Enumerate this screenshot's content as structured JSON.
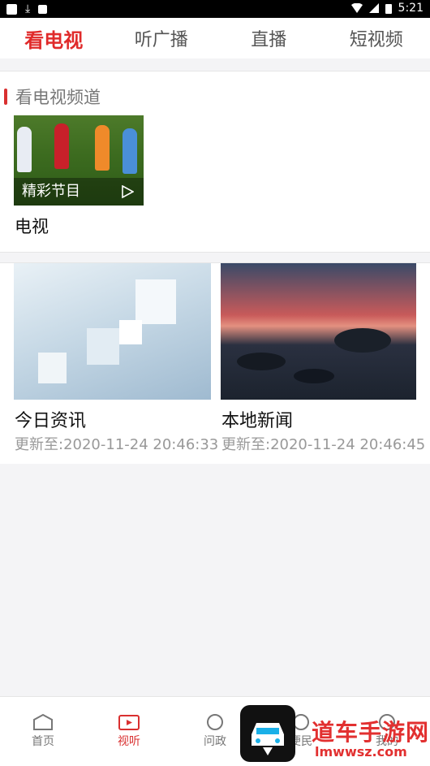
{
  "status_bar": {
    "time": "5:21"
  },
  "top_tabs": [
    {
      "label": "看电视",
      "active": true
    },
    {
      "label": "听广播",
      "active": false
    },
    {
      "label": "直播",
      "active": false
    },
    {
      "label": "短视频",
      "active": false
    }
  ],
  "channel_section": {
    "title": "看电视频道",
    "card": {
      "caption": "精彩节目",
      "title": "电视"
    }
  },
  "news": [
    {
      "title": "今日资讯",
      "updated": "更新至:2020-11-24 20:46:33"
    },
    {
      "title": "本地新闻",
      "updated": "更新至:2020-11-24 20:46:45"
    }
  ],
  "bottom_nav": [
    {
      "label": "首页",
      "icon": "home-icon"
    },
    {
      "label": "视听",
      "icon": "video-icon",
      "active": true
    },
    {
      "label": "问政",
      "icon": "circle-icon"
    },
    {
      "label": "便民",
      "icon": "circle-icon"
    },
    {
      "label": "我的",
      "icon": "user-icon"
    }
  ],
  "watermark": {
    "text": "道车手游网",
    "sub": "lmwwsz.com"
  },
  "colors": {
    "accent": "#e02a2a",
    "background": "#f4f4f6"
  }
}
